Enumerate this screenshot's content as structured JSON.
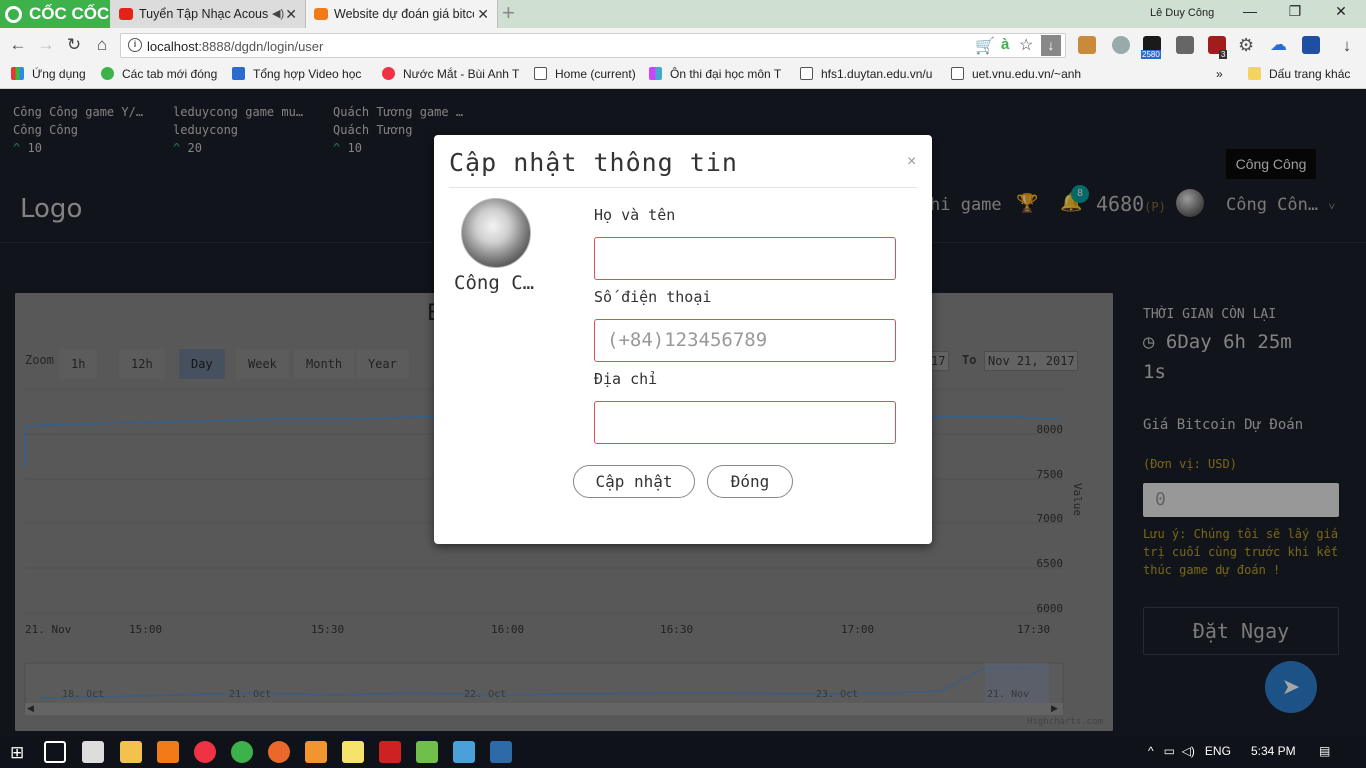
{
  "browser": {
    "brand": "CỐC CỐC",
    "tabs": [
      {
        "title": "Tuyển Tập Nhạc Acous",
        "active": false
      },
      {
        "title": "Website dự đoán giá bitco",
        "active": true
      }
    ],
    "window_user": "Lê Duy Công",
    "url_host": "localhost",
    "url_rest": ":8888/dgdn/login/user",
    "bookmarks": [
      "Ứng dụng",
      "Các tab mới đóng",
      "Tổng hợp Video học",
      "Nước Mắt - Bùi Anh T",
      "Home (current)",
      "Ôn thi đại học môn T",
      "hfs1.duytan.edu.vn/u",
      "uet.vnu.edu.vn/~anh"
    ],
    "other_bookmarks": "Dấu trang khác",
    "ext_badge_count": "2580",
    "ext_badge_small": "3"
  },
  "page": {
    "ticker": [
      {
        "game": "Công Công game Y/…",
        "user": "Công Công",
        "points": "10"
      },
      {
        "game": "leduycong game mu…",
        "user": "leduycong",
        "points": "20"
      },
      {
        "game": "Quách Tương game …",
        "user": "Quách Tương",
        "points": "10"
      }
    ],
    "logo": "Logo",
    "nav_game": "hi game",
    "notification_count": "8",
    "points": "4680",
    "points_unit": "(P)",
    "user_short": "Công Côn…",
    "tooltip": "Công Công"
  },
  "chart": {
    "title_fragment": "E",
    "zoom_label": "Zoom",
    "range_buttons": [
      "1h",
      "12h",
      "Day",
      "Week",
      "Month",
      "Year"
    ],
    "selected_range": "Day",
    "from_fragment": "17",
    "to_label": "To",
    "to_value": "Nov 21, 2017",
    "y_ticks": [
      "8000",
      "7500",
      "7000",
      "6500",
      "6000"
    ],
    "y_axis_label": "Value",
    "x_ticks": [
      "21. Nov",
      "15:00",
      "15:30",
      "16:00",
      "16:30",
      "17:00",
      "17:30"
    ],
    "navigator_ticks": [
      "18. Oct",
      "21. Oct",
      "22. Oct",
      "23. Oct",
      "21. Nov"
    ],
    "credit": "Highcharts.com"
  },
  "sidebar": {
    "time_left_label": "THỜI GIAN CÒN LẠI",
    "time_left_value_1": "6Day 6h 25m",
    "time_left_value_2": "1s",
    "prediction_label": "Giá Bitcoin Dự Đoán",
    "unit_label": "(Đơn vị: USD)",
    "prediction_input_placeholder": "0",
    "note": [
      "Lưu ý: Chúng tôi sẽ lấy giá",
      "trị cuối cùng trước khi kết",
      "thúc game dự đoán !"
    ],
    "submit_button": "Đặt Ngay"
  },
  "modal": {
    "title": "Cập nhật thông tin",
    "close": "×",
    "user_name": "Công C…",
    "name_label": "Họ và tên",
    "name_value": "",
    "phone_label": "Số điện thoại",
    "phone_placeholder": "(+84)123456789",
    "address_label": "Địa chỉ",
    "address_value": "",
    "update_button": "Cập nhật",
    "close_button": "Đóng"
  },
  "taskbar": {
    "language": "ENG",
    "time": "5:34 PM"
  },
  "colors": {
    "accent_green": "#30c67c",
    "modal_input_border": "#d9534f",
    "send_button": "#2d7fd0"
  }
}
